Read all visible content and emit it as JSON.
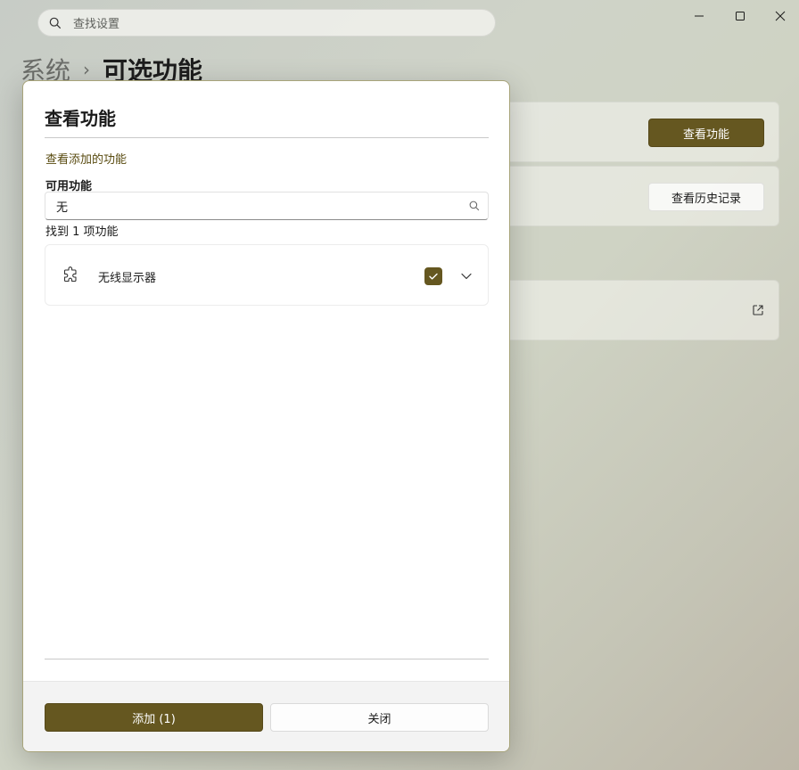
{
  "topbar": {
    "search_placeholder": "查找设置"
  },
  "window_controls": [
    "minimize-icon",
    "maximize-icon",
    "close-icon"
  ],
  "breadcrumb": {
    "parent": "系统",
    "separator": "›",
    "current": "可选功能"
  },
  "background_cards": {
    "view_features_button": "查看功能",
    "view_history_button": "查看历史记录",
    "external_link_icon": "open-external-icon"
  },
  "dialog": {
    "title": "查看功能",
    "link": "查看添加的功能",
    "available_label": "可用功能",
    "search_value": "无",
    "result_count": "找到 1 项功能",
    "features": [
      {
        "name": "无线显示器",
        "checked": true,
        "icon": "puzzle-icon"
      }
    ],
    "primary_button": "添加 (1)",
    "secondary_button": "关闭"
  },
  "colors": {
    "accent": "#655720"
  }
}
